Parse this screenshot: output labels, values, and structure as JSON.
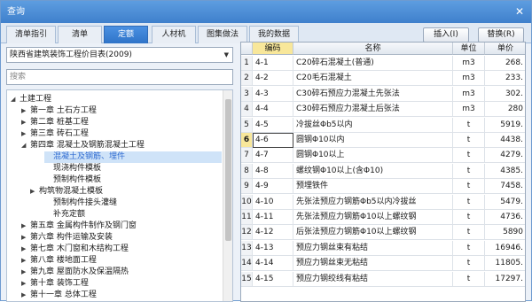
{
  "window": {
    "title": "查询",
    "close": "✕"
  },
  "tabs": [
    {
      "label": "清单指引",
      "active": false
    },
    {
      "label": "清单",
      "active": false
    },
    {
      "label": "定额",
      "active": true
    },
    {
      "label": "人材机",
      "active": false
    },
    {
      "label": "图集做法",
      "active": false
    },
    {
      "label": "我的数据",
      "active": false
    }
  ],
  "buttons": {
    "insert": "插入(I)",
    "replace": "替换(R)"
  },
  "library": {
    "selected": "陕西省建筑装饰工程价目表(2009)",
    "arrow": "▼"
  },
  "search": {
    "placeholder": "搜索"
  },
  "tree": [
    {
      "label": "土建工程",
      "toggle": "◢",
      "level": 0
    },
    {
      "label": "第一章 土石方工程",
      "toggle": "▶",
      "level": 1
    },
    {
      "label": "第二章 桩基工程",
      "toggle": "▶",
      "level": 1
    },
    {
      "label": "第三章 砖石工程",
      "toggle": "▶",
      "level": 1
    },
    {
      "label": "第四章 混凝土及钢筋混凝土工程",
      "toggle": "◢",
      "level": 1
    },
    {
      "label": "混凝土及钢筋、埋件",
      "toggle": "",
      "level": 3,
      "selected": true
    },
    {
      "label": "现浇构件模板",
      "toggle": "",
      "level": 3
    },
    {
      "label": "预制构件模板",
      "toggle": "",
      "level": 3
    },
    {
      "label": "构筑物混凝土模板",
      "toggle": "▶",
      "level": 2
    },
    {
      "label": "预制构件接头灌缝",
      "toggle": "",
      "level": 3
    },
    {
      "label": "补充定额",
      "toggle": "",
      "level": 3
    },
    {
      "label": "第五章 金属构件制作及钢门窗",
      "toggle": "▶",
      "level": 1
    },
    {
      "label": "第六章 构件运输及安装",
      "toggle": "▶",
      "level": 1
    },
    {
      "label": "第七章 木门窗和木结构工程",
      "toggle": "▶",
      "level": 1
    },
    {
      "label": "第八章 楼地面工程",
      "toggle": "▶",
      "level": 1
    },
    {
      "label": "第九章 屋面防水及保温隔热",
      "toggle": "▶",
      "level": 1
    },
    {
      "label": "第十章 装饰工程",
      "toggle": "▶",
      "level": 1
    },
    {
      "label": "第十一章 总体工程",
      "toggle": "▶",
      "level": 1
    }
  ],
  "table": {
    "headers": [
      "",
      "编码",
      "名称",
      "单位",
      "单价"
    ],
    "sorted_column": "编码",
    "current_row": 6,
    "rows": [
      {
        "n": "1",
        "code": "4-1",
        "name": "C20碎石混凝土(普通)",
        "unit": "m3",
        "price": "268."
      },
      {
        "n": "2",
        "code": "4-2",
        "name": "C20毛石混凝土",
        "unit": "m3",
        "price": "233."
      },
      {
        "n": "3",
        "code": "4-3",
        "name": "C30碎石预应力混凝土先张法",
        "unit": "m3",
        "price": "302."
      },
      {
        "n": "4",
        "code": "4-4",
        "name": "C30碎石预应力混凝土后张法",
        "unit": "m3",
        "price": "280"
      },
      {
        "n": "5",
        "code": "4-5",
        "name": "冷拔丝Φb5以内",
        "unit": "t",
        "price": "5919."
      },
      {
        "n": "6",
        "code": "4-6",
        "name": "圆钢Φ10以内",
        "unit": "t",
        "price": "4438."
      },
      {
        "n": "7",
        "code": "4-7",
        "name": "圆钢Φ10以上",
        "unit": "t",
        "price": "4279."
      },
      {
        "n": "8",
        "code": "4-8",
        "name": "螺纹钢Φ10以上(含Φ10)",
        "unit": "t",
        "price": "4385."
      },
      {
        "n": "9",
        "code": "4-9",
        "name": "预埋铁件",
        "unit": "t",
        "price": "7458."
      },
      {
        "n": "10",
        "code": "4-10",
        "name": "先张法预应力钢筋Φb5以内冷拔丝",
        "unit": "t",
        "price": "5479."
      },
      {
        "n": "11",
        "code": "4-11",
        "name": "先张法预应力钢筋Φ10以上螺纹钢",
        "unit": "t",
        "price": "4736."
      },
      {
        "n": "12",
        "code": "4-12",
        "name": "后张法预应力钢筋Φ10以上螺纹钢",
        "unit": "t",
        "price": "5890"
      },
      {
        "n": "13",
        "code": "4-13",
        "name": "预应力钢丝束有粘结",
        "unit": "t",
        "price": "16946."
      },
      {
        "n": "14",
        "code": "4-14",
        "name": "预应力钢丝束无粘结",
        "unit": "t",
        "price": "11805."
      },
      {
        "n": "15",
        "code": "4-15",
        "name": "预应力钢绞线有粘结",
        "unit": "t",
        "price": "17297."
      }
    ]
  }
}
